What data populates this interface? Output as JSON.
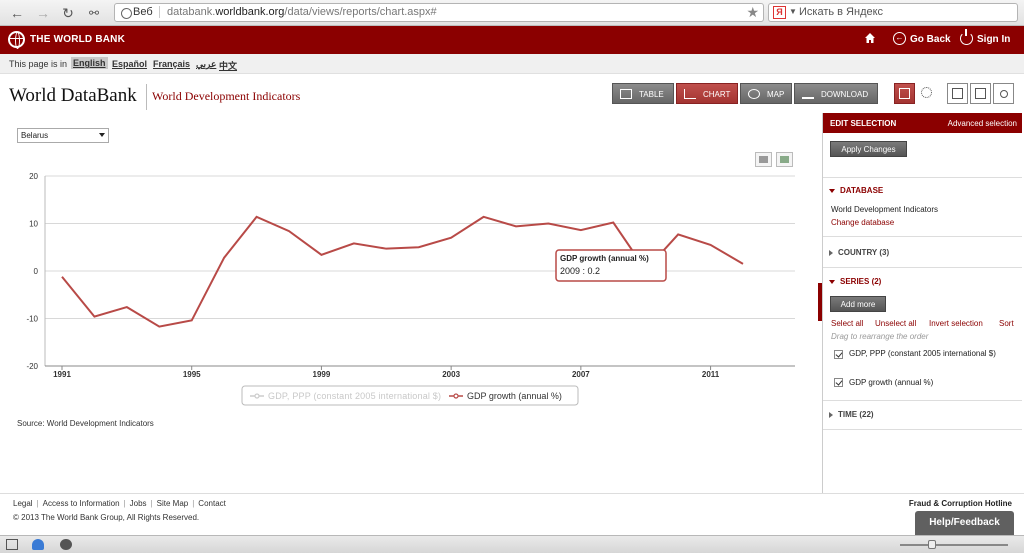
{
  "browser": {
    "tab_label": "Веб",
    "url_prefix": "databank.",
    "url_domain": "worldbank.org",
    "url_path": "/data/views/reports/chart.aspx#",
    "search_placeholder": "Искать в Яндекс",
    "yandex_badge": "Я"
  },
  "header": {
    "logo_text": "THE WORLD BANK",
    "go_back": "Go Back",
    "sign_in": "Sign In"
  },
  "languages": {
    "prefix": "This page is in",
    "items": [
      "English",
      "Español",
      "Français",
      "عربي",
      "中文"
    ],
    "active": "English"
  },
  "title": {
    "main": "World DataBank",
    "sub": "World Development Indicators"
  },
  "toolbar": {
    "table": "TABLE",
    "chart": "CHART",
    "map": "MAP",
    "download": "DOWNLOAD"
  },
  "country_select": {
    "value": "Belarus"
  },
  "chart_data": {
    "type": "line",
    "x": [
      1991,
      1992,
      1993,
      1994,
      1995,
      1996,
      1997,
      1998,
      1999,
      2000,
      2001,
      2002,
      2003,
      2004,
      2005,
      2006,
      2007,
      2008,
      2009,
      2010,
      2011,
      2012
    ],
    "series": [
      {
        "name": "GDP growth (annual %)",
        "values": [
          -1.2,
          -9.6,
          -7.6,
          -11.7,
          -10.4,
          2.8,
          11.4,
          8.4,
          3.4,
          5.8,
          4.7,
          5.0,
          7.0,
          11.4,
          9.4,
          10.0,
          8.6,
          10.2,
          0.2,
          7.7,
          5.5,
          1.5
        ],
        "color": "#b84a47"
      }
    ],
    "legend_series": [
      "GDP, PPP (constant 2005 international $)",
      "GDP growth (annual %)"
    ],
    "legend_display": [
      "GDP, PPP (constant 2005 international $)",
      "GDP growth (annual %)"
    ],
    "hidden_series": [
      "GDP, PPP (constant 2005 international $)"
    ],
    "ylim": [
      -20,
      20
    ],
    "yticks": [
      -20,
      -10,
      0,
      10,
      20
    ],
    "xticks": [
      1991,
      1995,
      1999,
      2003,
      2007,
      2011
    ],
    "grid": true,
    "legend_position": "bottom",
    "tooltip": {
      "title": "GDP growth (annual %)",
      "text": "2009 : 0.2",
      "year": 2009
    }
  },
  "source": "Source: World Development Indicators",
  "panel": {
    "edit_selection": "EDIT SELECTION",
    "advanced": "Advanced selection",
    "apply": "Apply Changes",
    "database_head": "DATABASE",
    "database_name": "World Development Indicators",
    "change_database": "Change database",
    "country_head": "COUNTRY (3)",
    "series_head": "SERIES (2)",
    "add_more": "Add more",
    "select_all": "Select all",
    "unselect_all": "Unselect all",
    "invert": "Invert selection",
    "sort": "Sort",
    "drag_hint": "Drag to rearrange the order",
    "series_items": [
      "GDP, PPP (constant 2005 international $)",
      "GDP growth (annual %)"
    ],
    "time_head": "TIME (22)"
  },
  "footer": {
    "links": [
      "Legal",
      "Access to Information",
      "Jobs",
      "Site Map",
      "Contact"
    ],
    "copyright": "© 2013 The World Bank Group, All Rights Reserved.",
    "fraud": "Fraud & Corruption Hotline",
    "help": "Help/Feedback"
  }
}
